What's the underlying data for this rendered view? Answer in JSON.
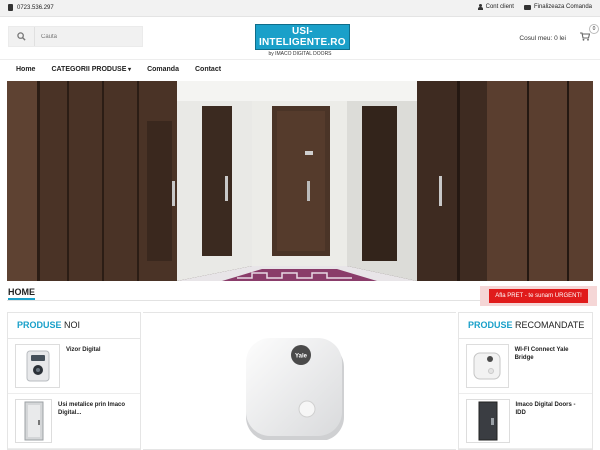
{
  "topbar": {
    "phone": "0723.536.297",
    "account_label": "Cont client",
    "checkout_label": "Finalizeaza Comanda"
  },
  "search": {
    "placeholder": "Cauta"
  },
  "logo": {
    "main": "USI-INTELIGENTE.RO",
    "sub": "by IMACO DIGITAL DOORS"
  },
  "cart": {
    "label": "Cosul meu: 0 lei",
    "count": "0"
  },
  "nav": {
    "items": [
      {
        "label": "Home"
      },
      {
        "label": "CATEGORII PRODUSE"
      },
      {
        "label": "Comanda"
      },
      {
        "label": "Contact"
      }
    ]
  },
  "breadcrumb": {
    "home": "HOME"
  },
  "urgent_button": {
    "label": "Afla PRET - te sunam URGENT!"
  },
  "new_products": {
    "title_bold": "PRODUSE",
    "title_rest": " NOI",
    "items": [
      {
        "name": "Vizor Digital"
      },
      {
        "name": "Usi metalice prin Imaco Digital..."
      }
    ]
  },
  "recommended_products": {
    "title_bold": "PRODUSE",
    "title_rest": " RECOMANDATE",
    "items": [
      {
        "name": "WI-FI Connect Yale Bridge"
      },
      {
        "name": "Imaco Digital Doors - IDD"
      }
    ]
  },
  "featured": {
    "brand_text": "Yale"
  },
  "colors": {
    "accent": "#1aa0c9",
    "urgent": "#e01b1b"
  }
}
